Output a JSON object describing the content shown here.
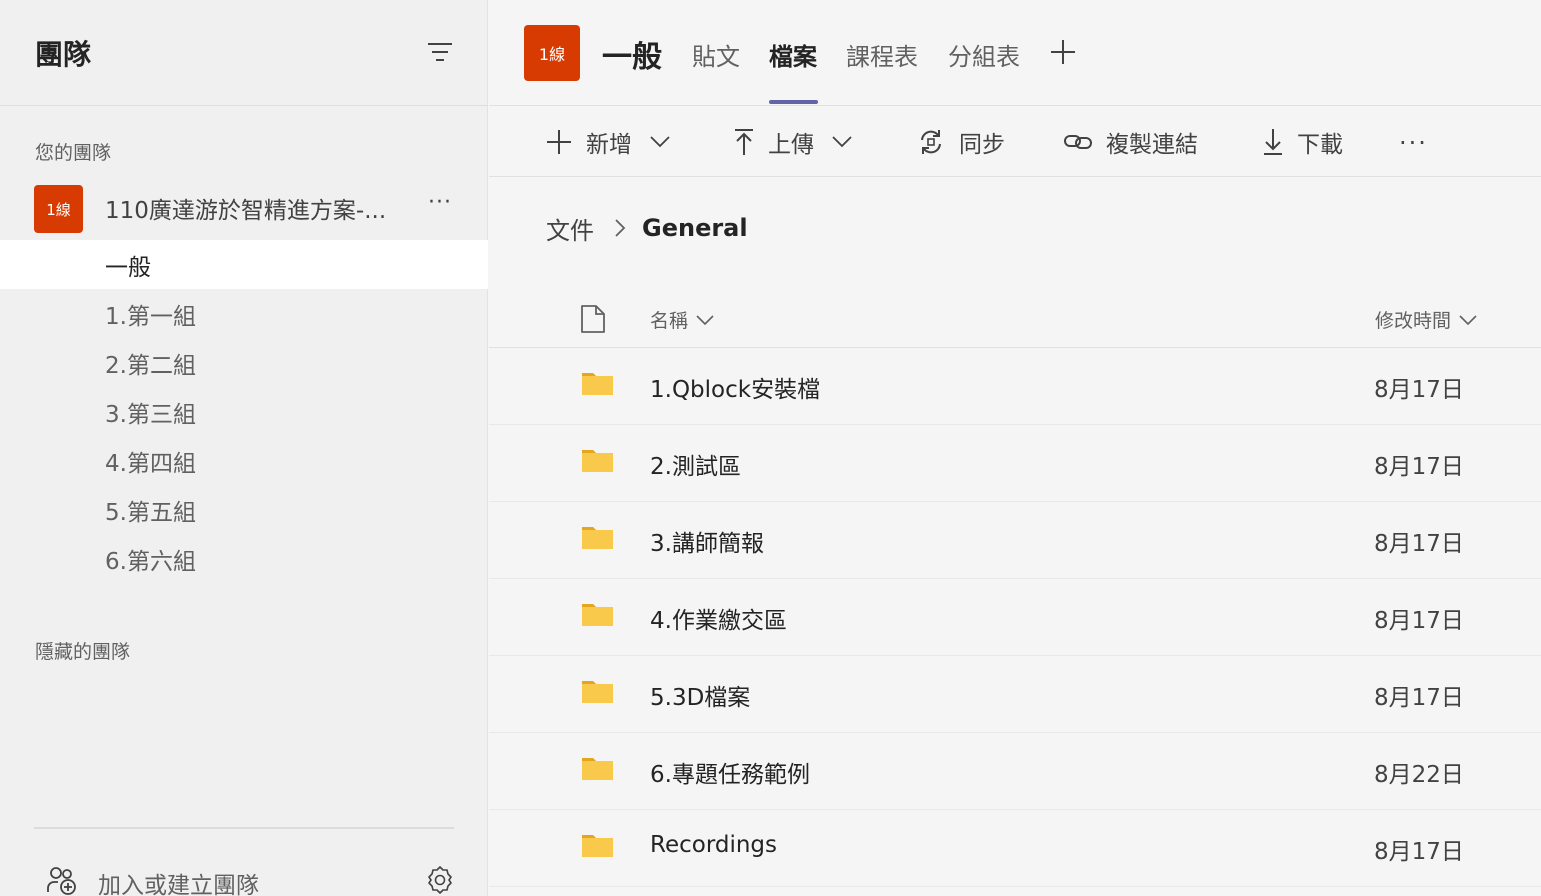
{
  "sidebar": {
    "title": "團隊",
    "your_teams_label": "您的團隊",
    "team": {
      "avatar_text": "1線",
      "name": "110廣達游於智精進方案-...",
      "more": "···"
    },
    "channels": [
      {
        "label": "一般",
        "active": true
      },
      {
        "label": "1.第一組",
        "active": false
      },
      {
        "label": "2.第二組",
        "active": false
      },
      {
        "label": "3.第三組",
        "active": false
      },
      {
        "label": "4.第四組",
        "active": false
      },
      {
        "label": "5.第五組",
        "active": false
      },
      {
        "label": "6.第六組",
        "active": false
      }
    ],
    "hidden_teams_label": "隱藏的團隊",
    "join_label": "加入或建立團隊"
  },
  "header": {
    "avatar_text": "1線",
    "channel_title": "一般",
    "tabs": [
      {
        "label": "貼文",
        "active": false
      },
      {
        "label": "檔案",
        "active": true
      },
      {
        "label": "課程表",
        "active": false
      },
      {
        "label": "分組表",
        "active": false
      }
    ]
  },
  "toolbar": {
    "new_label": "新增",
    "upload_label": "上傳",
    "sync_label": "同步",
    "copy_link_label": "複製連結",
    "download_label": "下載",
    "more": "···"
  },
  "breadcrumb": {
    "root": "文件",
    "current": "General"
  },
  "table": {
    "col_name": "名稱",
    "col_modified": "修改時間",
    "rows": [
      {
        "name": "1.Qblock安裝檔",
        "modified": "8月17日"
      },
      {
        "name": "2.測試區",
        "modified": "8月17日"
      },
      {
        "name": "3.講師簡報",
        "modified": "8月17日"
      },
      {
        "name": "4.作業繳交區",
        "modified": "8月17日"
      },
      {
        "name": "5.3D檔案",
        "modified": "8月17日"
      },
      {
        "name": "6.專題任務範例",
        "modified": "8月22日"
      },
      {
        "name": "Recordings",
        "modified": "8月17日"
      }
    ]
  },
  "colors": {
    "team_avatar": "#d83b01",
    "tab_accent": "#6264a7",
    "folder": "#f8c94a"
  },
  "icons": {
    "filter": "filter-icon",
    "folder": "folder-icon",
    "file": "file-icon",
    "settings": "gear-icon",
    "join": "add-people-icon"
  }
}
